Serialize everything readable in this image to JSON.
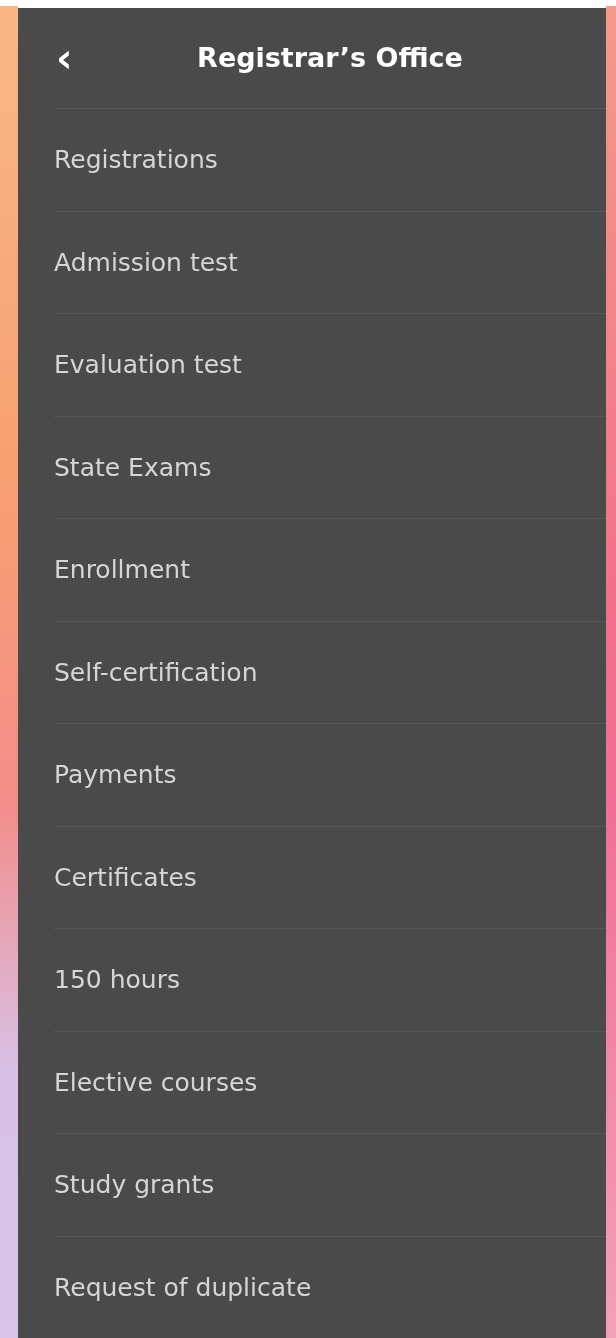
{
  "header": {
    "back_icon": "‹",
    "title": "Registrar’s Office"
  },
  "menu_items": [
    {
      "label": "Registrations"
    },
    {
      "label": "Admission test"
    },
    {
      "label": "Evaluation test"
    },
    {
      "label": "State Exams"
    },
    {
      "label": "Enrollment"
    },
    {
      "label": "Self-certification"
    },
    {
      "label": "Payments"
    },
    {
      "label": "Certificates"
    },
    {
      "label": "150 hours"
    },
    {
      "label": "Elective courses"
    },
    {
      "label": "Study grants"
    },
    {
      "label": "Request of duplicate"
    }
  ]
}
